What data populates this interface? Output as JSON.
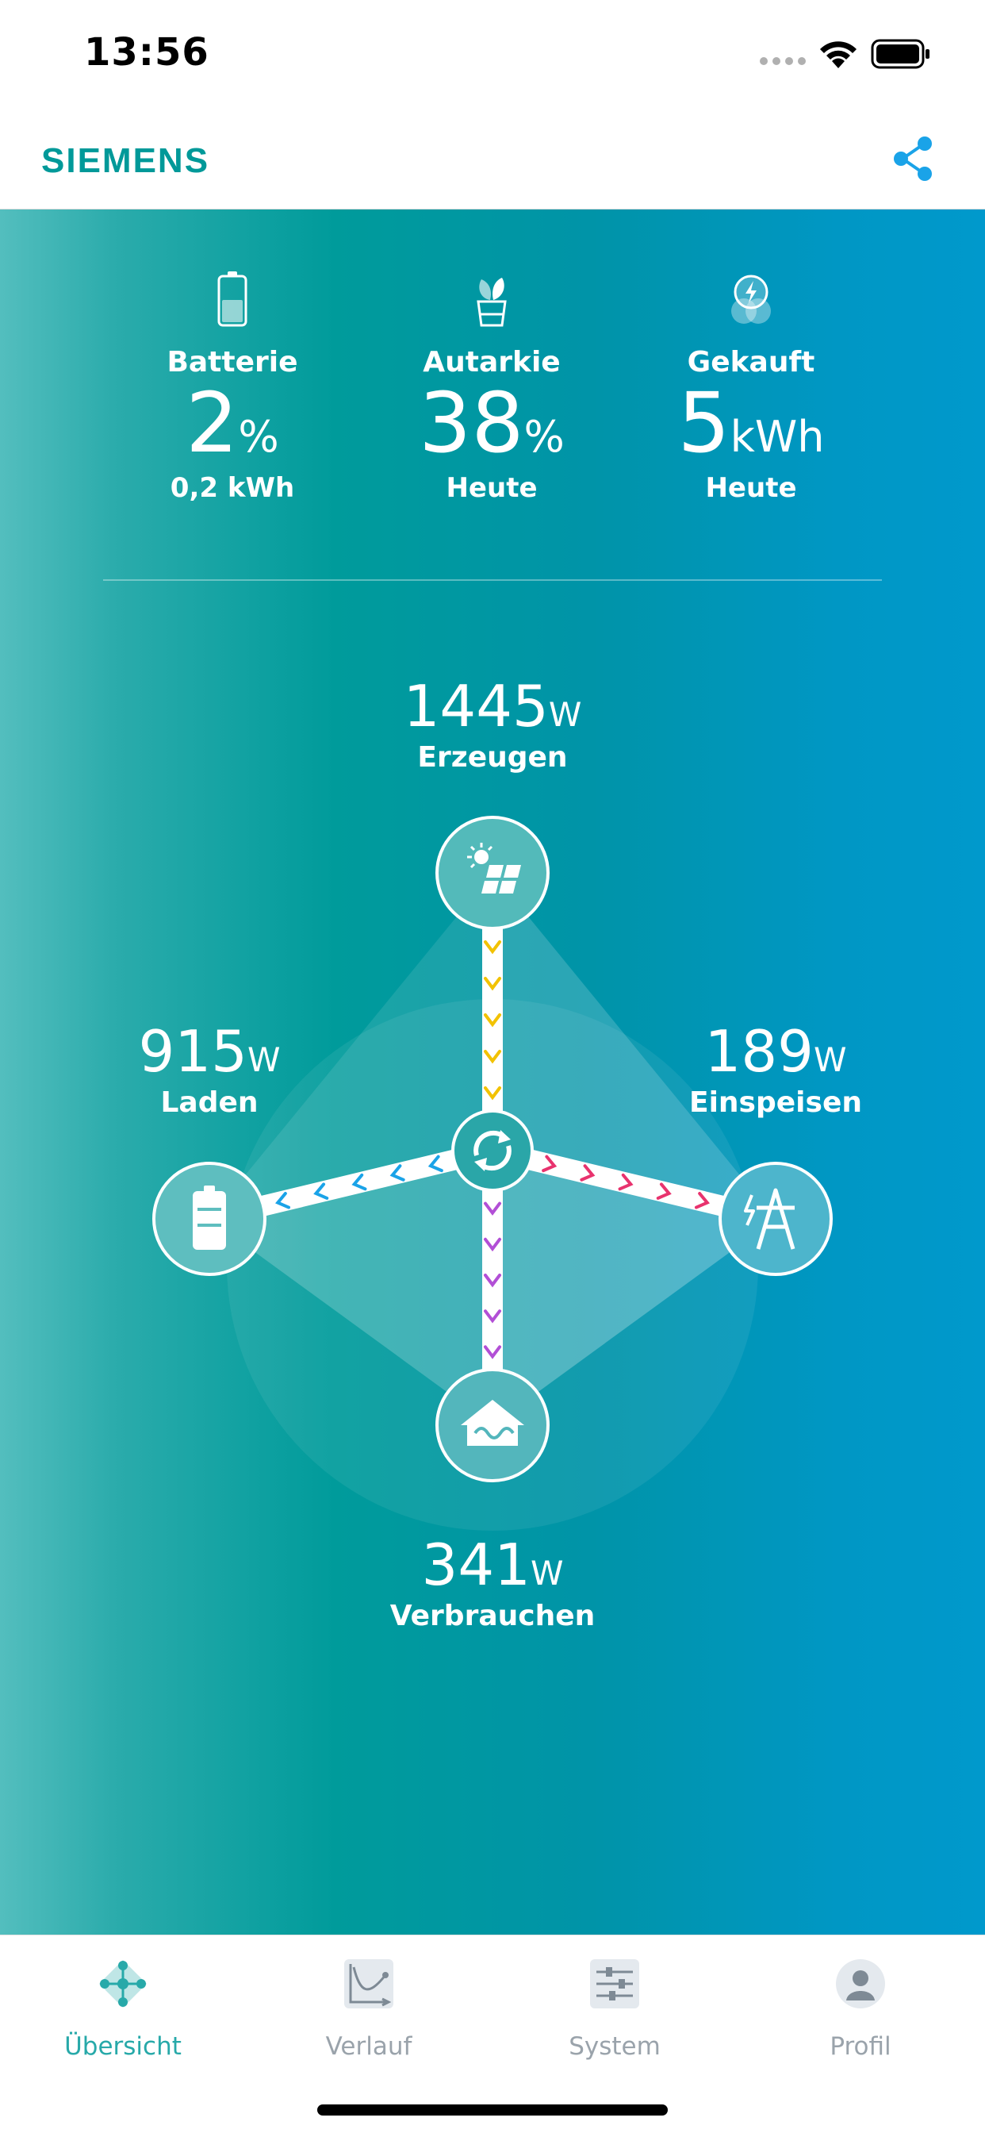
{
  "status_bar": {
    "time": "13:56"
  },
  "header": {
    "brand": "SIEMENS"
  },
  "stats": [
    {
      "label": "Batterie",
      "value": "2",
      "unit": "%",
      "sub": "0,2 kWh",
      "icon": "battery-level-icon",
      "fill": 0.02
    },
    {
      "label": "Autarkie",
      "value": "38",
      "unit": "%",
      "sub": "Heute",
      "icon": "plant-pot-icon"
    },
    {
      "label": "Gekauft",
      "value": "5",
      "unit": "kWh",
      "sub": "Heute",
      "icon": "grid-power-icon"
    }
  ],
  "flows": {
    "produce": {
      "value": "1445",
      "unit": "W",
      "label": "Erzeugen",
      "icon": "solar-panel-icon",
      "color": "#f2c200"
    },
    "charge": {
      "value": "915",
      "unit": "W",
      "label": "Laden",
      "icon": "battery-icon",
      "color": "#1aa3e8"
    },
    "feed": {
      "value": "189",
      "unit": "W",
      "label": "Einspeisen",
      "icon": "power-tower-icon",
      "color": "#e8336e"
    },
    "consume": {
      "value": "341",
      "unit": "W",
      "label": "Verbrauchen",
      "icon": "house-icon",
      "color": "#b24fd6"
    },
    "hub_icon": "refresh-icon"
  },
  "tabs": [
    {
      "label": "Übersicht",
      "icon": "overview-network-icon",
      "active": true
    },
    {
      "label": "Verlauf",
      "icon": "chart-curve-icon",
      "active": false
    },
    {
      "label": "System",
      "icon": "sliders-icon",
      "active": false
    },
    {
      "label": "Profil",
      "icon": "profile-icon",
      "active": false
    }
  ],
  "colors": {
    "brand": "#009999",
    "accent": "#27a9a9",
    "share": "#1aa3e8"
  }
}
